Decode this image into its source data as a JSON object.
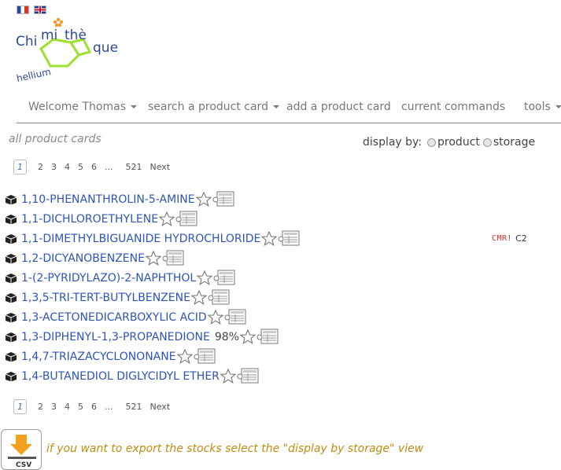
{
  "languages": [
    {
      "code": "fr",
      "icon": "flag-france-icon"
    },
    {
      "code": "en",
      "icon": "flag-uk-icon"
    }
  ],
  "logo": {
    "word_left": "Chi",
    "word_mid1": "mi",
    "word_mid2": "thè",
    "word_right": "que",
    "sub": "hellium",
    "accent": "#9ee030",
    "text_color": "#2d4a96"
  },
  "navbar": {
    "welcome": "Welcome Thomas",
    "search": "search a product card",
    "add": "add a product card",
    "commands": "current commands",
    "tools": "tools"
  },
  "all_cards_label": "all product cards",
  "display_by": {
    "label": "display by:",
    "option_product": "product",
    "option_storage": "storage"
  },
  "pagination": {
    "pages": [
      "1",
      "2",
      "3",
      "4",
      "5",
      "6",
      "...",
      "521"
    ],
    "current": "1",
    "next": "Next"
  },
  "products": [
    {
      "name": "1,10-PHENANTHROLIN-5-AMINE"
    },
    {
      "name": "1,1-DICHLOROETHYLENE"
    },
    {
      "name": "1,1-DIMETHYLBIGUANIDE HYDROCHLORIDE",
      "cmr": "CMR!",
      "cmr_code": "C2"
    },
    {
      "name": "1,2-DICYANOBENZENE"
    },
    {
      "name": "1-(2-PYRIDYLAZO)-2-NAPHTHOL"
    },
    {
      "name": "1,3,5-TRI-TERT-BUTYLBENZENE"
    },
    {
      "name": "1,3-ACETONEDICARBOXYLIC ACID"
    },
    {
      "name": "1,3-DIPHENYL-1,3-PROPANEDIONE",
      "purity": "98%"
    },
    {
      "name": "1,4,7-TRIAZACYCLONONANE"
    },
    {
      "name": "1,4-BUTANEDIOL DIGLYCIDYL ETHER"
    }
  ],
  "export": {
    "csv_label": "CSV",
    "note": "if you want to export the stocks select the \"display by storage\" view"
  },
  "colors": {
    "link": "#2d55b8",
    "note": "#c08c10",
    "cmr": "#d53030"
  }
}
